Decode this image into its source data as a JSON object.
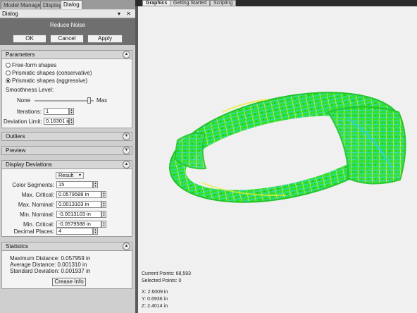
{
  "left_tabs": [
    "Model Manager",
    "Display",
    "Dialog"
  ],
  "dialog_header": {
    "label": "Dialog",
    "icons": "▾ ✕"
  },
  "dialog_title": "Reduce Noise",
  "buttons": {
    "ok": "OK",
    "cancel": "Cancel",
    "apply": "Apply"
  },
  "parameters": {
    "title": "Parameters",
    "options": [
      "Free-form shapes",
      "Prismatic shapes (conservative)",
      "Prismatic shapes (aggressive)"
    ],
    "selected_index": 2,
    "smoothness_label": "Smoothness Level:",
    "slider_min": "None",
    "slider_max": "Max",
    "slider_value": 0.92,
    "iterations_label": "Iterations:",
    "iterations_value": "1",
    "deviation_label": "Deviation Limit:",
    "deviation_value": "0.16301 in"
  },
  "outliers": {
    "title": "Outliers"
  },
  "preview": {
    "title": "Preview"
  },
  "display_deviations": {
    "title": "Display Deviations",
    "mode": "Result",
    "color_segments_label": "Color Segments:",
    "color_segments_value": "15",
    "max_critical_label": "Max. Critical:",
    "max_critical_value": "0.0579588 in",
    "max_nominal_label": "Max. Nominal:",
    "max_nominal_value": "0.0013103 in",
    "min_nominal_label": "Min. Nominal:",
    "min_nominal_value": "-0.0013103 in",
    "min_critical_label": "Min. Critical:",
    "min_critical_value": "-0.0579588 in",
    "decimal_label": "Decimal Places:",
    "decimal_value": "4"
  },
  "statistics": {
    "title": "Statistics",
    "max_distance": "Maximum Distance: 0.057959 in",
    "avg_distance": "Average Distance: 0.001310 in",
    "std_deviation": "Standard Deviation: 0.001937 in",
    "button": "Crease Info"
  },
  "view_tabs": [
    "Graphics",
    "Getting Started",
    "Scripting"
  ],
  "viewport_info": {
    "current_points": "Current Points: 68,593",
    "selected_points": "Selected Points: 0",
    "x": "X:  2.6009 in",
    "y": "Y:  0.6936 in",
    "z": "Z:  2.4014 in"
  },
  "colors": {
    "mesh_green": "#2fe12f",
    "mesh_cyan": "#2fd6c8",
    "mesh_yellow": "#e7ef3a",
    "panel_dark": "#6f6f6f"
  }
}
